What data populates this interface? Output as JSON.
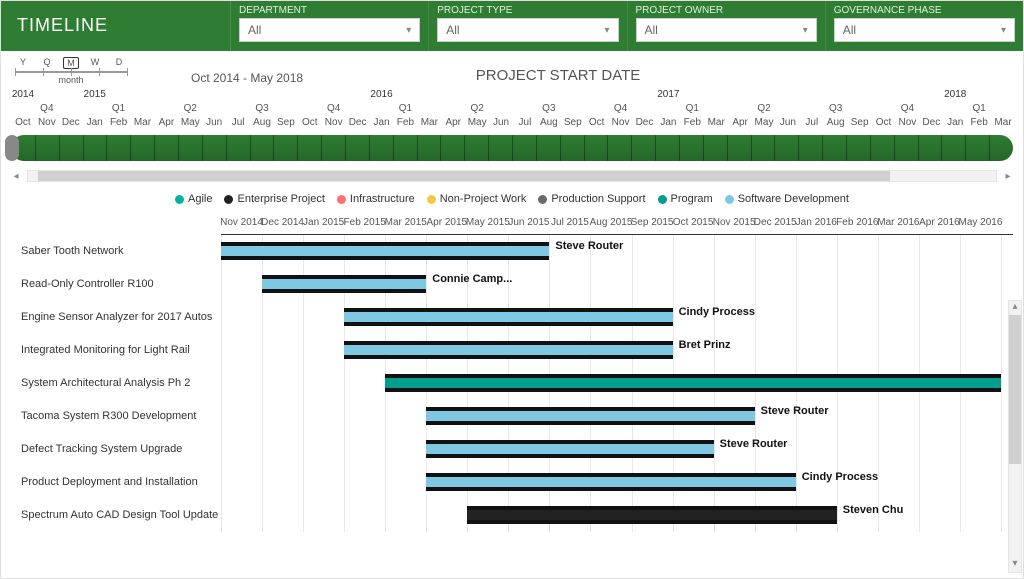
{
  "header": {
    "title": "TIMELINE",
    "filters": [
      {
        "label": "DEPARTMENT",
        "value": "All"
      },
      {
        "label": "PROJECT TYPE",
        "value": "All"
      },
      {
        "label": "PROJECT OWNER",
        "value": "All"
      },
      {
        "label": "GOVERNANCE PHASE",
        "value": "All"
      }
    ]
  },
  "zoom": {
    "letters": [
      "Y",
      "Q",
      "M",
      "W",
      "D"
    ],
    "selected_index": 2,
    "label": "month"
  },
  "range_text": "Oct 2014 - May 2018",
  "chart_title": "PROJECT START DATE",
  "timeline": {
    "years": [
      "2014",
      "2015",
      "2016",
      "2017",
      "2018"
    ],
    "quarters": [
      "Q4",
      "Q1",
      "Q2",
      "Q3",
      "Q4",
      "Q1",
      "Q2",
      "Q3",
      "Q4",
      "Q1",
      "Q2",
      "Q3",
      "Q4",
      "Q1"
    ],
    "months": [
      "Oct",
      "Nov",
      "Dec",
      "Jan",
      "Feb",
      "Mar",
      "Apr",
      "May",
      "Jun",
      "Jul",
      "Aug",
      "Sep",
      "Oct",
      "Nov",
      "Dec",
      "Jan",
      "Feb",
      "Mar",
      "Apr",
      "May",
      "Jun",
      "Jul",
      "Aug",
      "Sep",
      "Oct",
      "Nov",
      "Dec",
      "Jan",
      "Feb",
      "Mar",
      "Apr",
      "May",
      "Jun",
      "Jul",
      "Aug",
      "Sep",
      "Oct",
      "Nov",
      "Dec",
      "Jan",
      "Feb",
      "Mar"
    ]
  },
  "legend": [
    {
      "name": "Agile",
      "color": "#00b3a1"
    },
    {
      "name": "Enterprise Project",
      "color": "#222222"
    },
    {
      "name": "Infrastructure",
      "color": "#ff6f6f"
    },
    {
      "name": "Non-Project Work",
      "color": "#f2c744"
    },
    {
      "name": "Production Support",
      "color": "#6b6b6b"
    },
    {
      "name": "Program",
      "color": "#009e8e"
    },
    {
      "name": "Software Development",
      "color": "#7ec8e3"
    }
  ],
  "gantt_months": [
    "Nov 2014",
    "Dec 2014",
    "Jan 2015",
    "Feb 2015",
    "Mar 2015",
    "Apr 2015",
    "May 2015",
    "Jun 2015",
    "Jul 2015",
    "Aug 2015",
    "Sep 2015",
    "Oct 2015",
    "Nov 2015",
    "Dec 2015",
    "Jan 2016",
    "Feb 2016",
    "Mar 2016",
    "Apr 2016",
    "May 2016"
  ],
  "chart_data": {
    "type": "gantt",
    "title": "PROJECT START DATE",
    "x_range": [
      "Oct 2014",
      "May 2018"
    ],
    "series_legend": [
      "Agile",
      "Enterprise Project",
      "Infrastructure",
      "Non-Project Work",
      "Production Support",
      "Program",
      "Software Development"
    ],
    "rows": [
      {
        "task": "Saber Tooth Network",
        "owner": "Steve Router",
        "category": "Software Development",
        "start": "Nov 2014",
        "end": "Jun 2015"
      },
      {
        "task": "Read-Only Controller R100",
        "owner": "Connie Camp...",
        "category": "Software Development",
        "start": "Dec 2014",
        "end": "Mar 2015"
      },
      {
        "task": "Engine Sensor Analyzer for 2017 Autos",
        "owner": "Cindy Process",
        "category": "Software Development",
        "start": "Feb 2015",
        "end": "Sep 2015"
      },
      {
        "task": "Integrated Monitoring for Light Rail",
        "owner": "Bret Prinz",
        "category": "Software Development",
        "start": "Feb 2015",
        "end": "Sep 2015"
      },
      {
        "task": "System Architectural Analysis Ph 2",
        "owner": "",
        "category": "Program",
        "start": "Mar 2015",
        "end": "May 2016"
      },
      {
        "task": "Tacoma System R300 Development",
        "owner": "Steve Router",
        "category": "Software Development",
        "start": "Apr 2015",
        "end": "Nov 2015"
      },
      {
        "task": "Defect Tracking System Upgrade",
        "owner": "Steve Router",
        "category": "Software Development",
        "start": "Apr 2015",
        "end": "Oct 2015"
      },
      {
        "task": "Product Deployment and Installation",
        "owner": "Cindy Process",
        "category": "Software Development",
        "start": "Apr 2015",
        "end": "Dec 2015"
      },
      {
        "task": "Spectrum Auto CAD Design Tool Update",
        "owner": "Steven Chu",
        "category": "Enterprise Project",
        "start": "May 2015",
        "end": "Jan 2016"
      }
    ]
  }
}
